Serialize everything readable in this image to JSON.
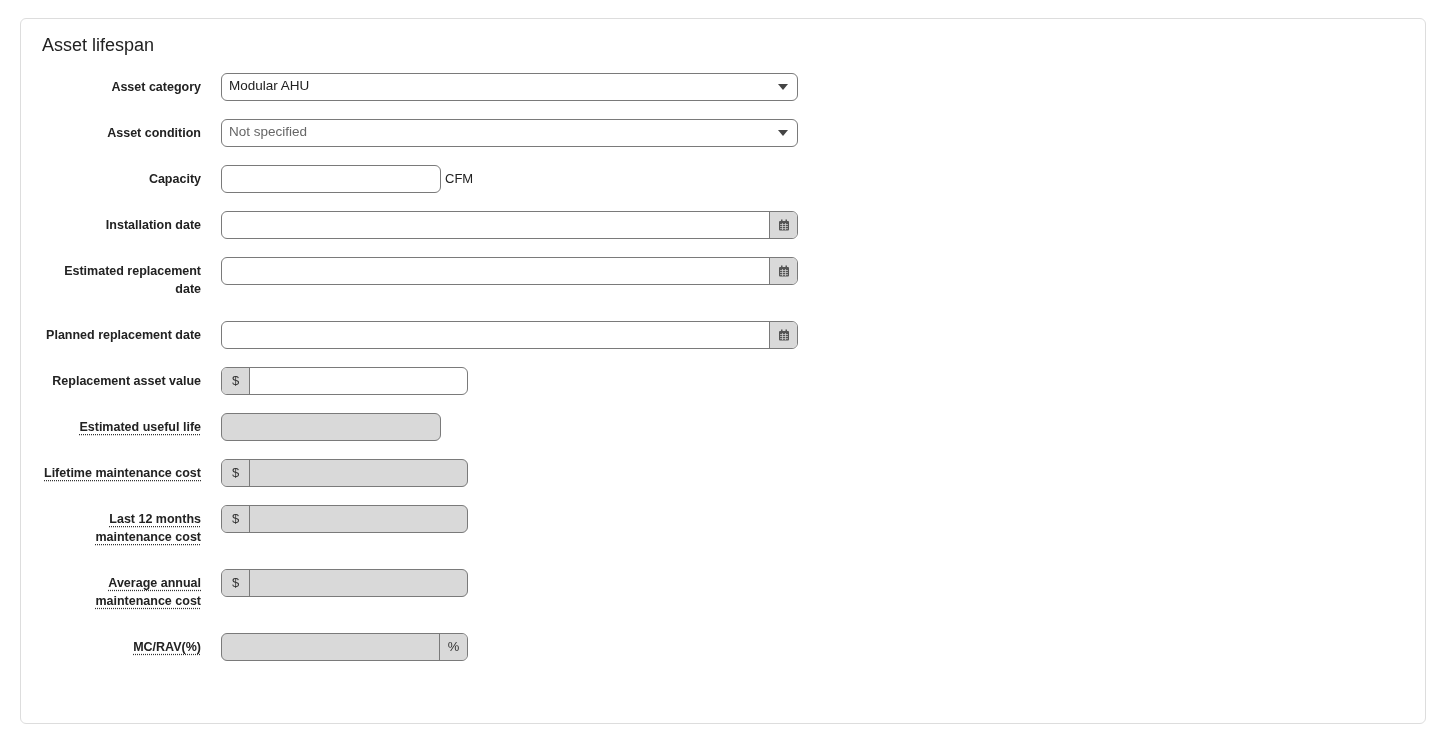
{
  "section": {
    "title": "Asset lifespan"
  },
  "fields": [
    {
      "label": "Asset category",
      "kind": "select",
      "value": "Modular AHU",
      "disabled": false,
      "has_tooltip": false
    },
    {
      "label": "Asset condition",
      "kind": "select",
      "placeholder": "Not specified",
      "disabled": false,
      "has_tooltip": false
    },
    {
      "label": "Capacity",
      "kind": "text",
      "unit": "CFM",
      "disabled": false,
      "has_tooltip": false
    },
    {
      "label": "Installation date",
      "kind": "date",
      "disabled": false,
      "has_tooltip": false
    },
    {
      "label": "Estimated replacement date",
      "kind": "date",
      "disabled": false,
      "has_tooltip": false
    },
    {
      "label": "Planned replacement date",
      "kind": "date",
      "disabled": false,
      "has_tooltip": false
    },
    {
      "label": "Replacement asset value",
      "kind": "money",
      "prefix": "$",
      "disabled": false,
      "has_tooltip": false
    },
    {
      "label": "Estimated useful life",
      "kind": "text",
      "disabled": true,
      "has_tooltip": true
    },
    {
      "label": "Lifetime maintenance cost",
      "kind": "money",
      "prefix": "$",
      "disabled": true,
      "has_tooltip": true
    },
    {
      "label": "Last 12 months maintenance cost",
      "kind": "money",
      "prefix": "$",
      "disabled": true,
      "has_tooltip": true
    },
    {
      "label": "Average annual maintenance cost",
      "kind": "money",
      "prefix": "$",
      "disabled": true,
      "has_tooltip": true
    },
    {
      "label": "MC/RAV(%)",
      "kind": "percent",
      "suffix": "%",
      "disabled": true,
      "has_tooltip": true
    }
  ]
}
